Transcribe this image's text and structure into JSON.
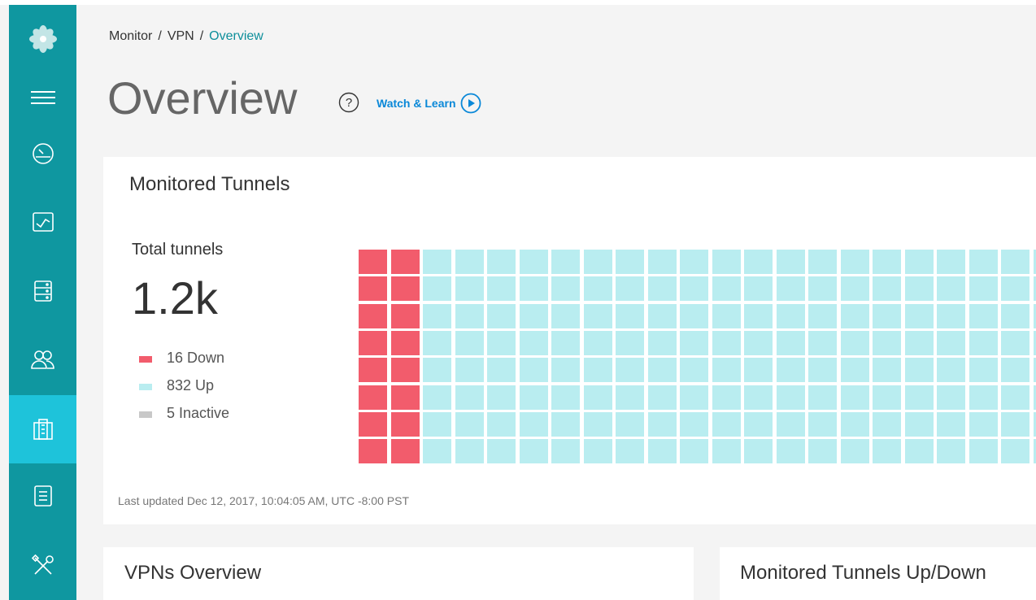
{
  "colors": {
    "sidebar": "#0f97a0",
    "sidebar_active": "#1ec3da",
    "down": "#f25c6c",
    "up": "#b9edf0",
    "inactive": "#c8c8c8",
    "link": "#0a88d8"
  },
  "sidebar": {
    "items": [
      {
        "icon": "logo-flower-icon"
      },
      {
        "icon": "hamburger-menu-icon"
      },
      {
        "icon": "dashboard-gauge-icon"
      },
      {
        "icon": "monitor-chart-icon"
      },
      {
        "icon": "server-icon"
      },
      {
        "icon": "users-icon"
      },
      {
        "icon": "vpn-icon",
        "active": true
      },
      {
        "icon": "document-icon"
      },
      {
        "icon": "tools-icon"
      }
    ]
  },
  "breadcrumb": {
    "items": [
      "Monitor",
      "VPN",
      "Overview"
    ],
    "separator": "/"
  },
  "header": {
    "title": "Overview",
    "help_icon": "question-circle-icon",
    "watch_learn_label": "Watch & Learn",
    "watch_learn_icon": "play-circle-icon"
  },
  "monitored_tunnels": {
    "title": "Monitored Tunnels",
    "total_label": "Total tunnels",
    "total_value": "1.2k",
    "legend": [
      {
        "label": "16 Down",
        "status": "down"
      },
      {
        "label": "832 Up",
        "status": "up"
      },
      {
        "label": "5 Inactive",
        "status": "inactive"
      }
    ],
    "waffle": {
      "rows": 8,
      "visible_columns": 22,
      "down_columns": 2
    },
    "last_updated": "Last updated Dec 12, 2017, 10:04:05 AM, UTC -8:00 PST"
  },
  "vpns_overview": {
    "title": "VPNs Overview"
  },
  "tunnels_updown": {
    "title": "Monitored Tunnels Up/Down"
  }
}
